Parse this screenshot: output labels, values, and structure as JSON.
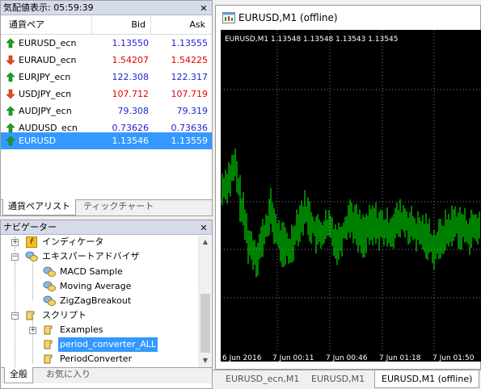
{
  "market_watch": {
    "title": "気配値表示: 05:59:39",
    "col_symbol": "通貨ペア",
    "col_bid": "Bid",
    "col_ask": "Ask",
    "rows": [
      {
        "symbol": "EURUSD_ecn",
        "bid": "1.13550",
        "ask": "1.13555",
        "dir": "up",
        "color": "blue"
      },
      {
        "symbol": "EURAUD_ecn",
        "bid": "1.54207",
        "ask": "1.54225",
        "dir": "down",
        "color": "red"
      },
      {
        "symbol": "EURJPY_ecn",
        "bid": "122.308",
        "ask": "122.317",
        "dir": "up",
        "color": "blue"
      },
      {
        "symbol": "USDJPY_ecn",
        "bid": "107.712",
        "ask": "107.719",
        "dir": "down",
        "color": "red"
      },
      {
        "symbol": "AUDJPY_ecn",
        "bid": "79.308",
        "ask": "79.319",
        "dir": "up",
        "color": "blue"
      },
      {
        "symbol": "AUDUSD_ecn",
        "bid": "0.73626",
        "ask": "0.73636",
        "dir": "up",
        "color": "blue"
      },
      {
        "symbol": "EURUSD",
        "bid": "1.13546",
        "ask": "1.13559",
        "dir": "up",
        "color": "blue",
        "selected": true
      }
    ],
    "tabs": [
      "通貨ペアリスト",
      "ティックチャート"
    ]
  },
  "navigator": {
    "title": "ナビゲーター",
    "items": {
      "indicators": "インディケータ",
      "experts": "エキスパートアドバイザ",
      "macd": "MACD Sample",
      "ma": "Moving Average",
      "zigzag": "ZigZagBreakout",
      "scripts": "スクリプト",
      "examples": "Examples",
      "period_all": "period_converter_ALL",
      "period": "PeriodConverter"
    },
    "tabs": [
      "全般",
      "お気に入り"
    ]
  },
  "chart": {
    "window_title": "EURUSD,M1 (offline)",
    "info_line": "EURUSD,M1  1.13548 1.13548 1.13543 1.13545",
    "time_labels": [
      "6 Jun 2016",
      "7 Jun 00:11",
      "7 Jun 00:46",
      "7 Jun 01:18",
      "7 Jun 01:50"
    ],
    "colors": {
      "background": "#000000",
      "candles": "#00ff00",
      "grid": "#808080",
      "text": "#ffffff"
    }
  },
  "chart_tabs": [
    "EURUSD_ecn,M1",
    "EURUSD,M1",
    "EURUSD,M1 (offline)"
  ]
}
